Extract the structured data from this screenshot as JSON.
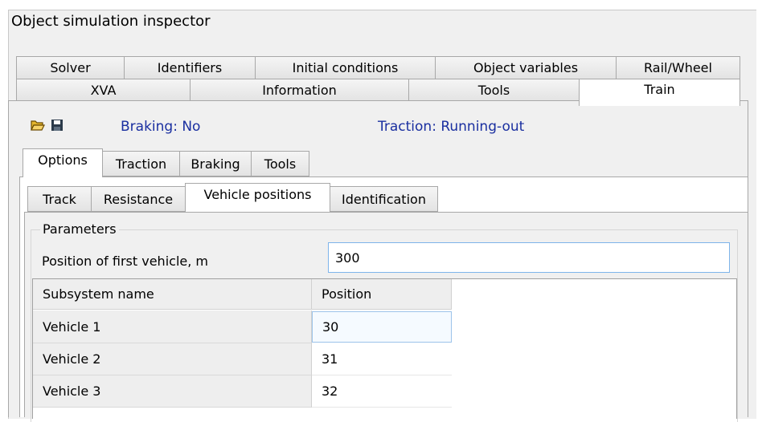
{
  "window": {
    "title": "Object simulation inspector"
  },
  "main_tabs_row1": [
    "Solver",
    "Identifiers",
    "Initial conditions",
    "Object variables",
    "Rail/Wheel"
  ],
  "main_tabs_row2": [
    "XVA",
    "Information",
    "Tools",
    "Train"
  ],
  "active_main_tab": "Train",
  "toolbar": {
    "open_icon": "folder-open-icon",
    "save_icon": "floppy-save-icon",
    "braking_status": "Braking: No",
    "traction_status": "Traction: Running-out",
    "status_color": "#1a2fa0"
  },
  "sub_tabs": [
    "Options",
    "Traction",
    "Braking",
    "Tools"
  ],
  "active_sub_tab": "Options",
  "options_tabs": [
    "Track",
    "Resistance",
    "Vehicle positions",
    "Identification"
  ],
  "active_options_tab": "Vehicle positions",
  "parameters": {
    "group_label": "Parameters",
    "first_vehicle_label": "Position of first vehicle, m",
    "first_vehicle_value": "300"
  },
  "table": {
    "headers": [
      "Subsystem name",
      "Position"
    ],
    "rows": [
      {
        "name": "Vehicle 1",
        "position": "30"
      },
      {
        "name": "Vehicle 2",
        "position": "31"
      },
      {
        "name": "Vehicle 3",
        "position": "32"
      }
    ]
  }
}
